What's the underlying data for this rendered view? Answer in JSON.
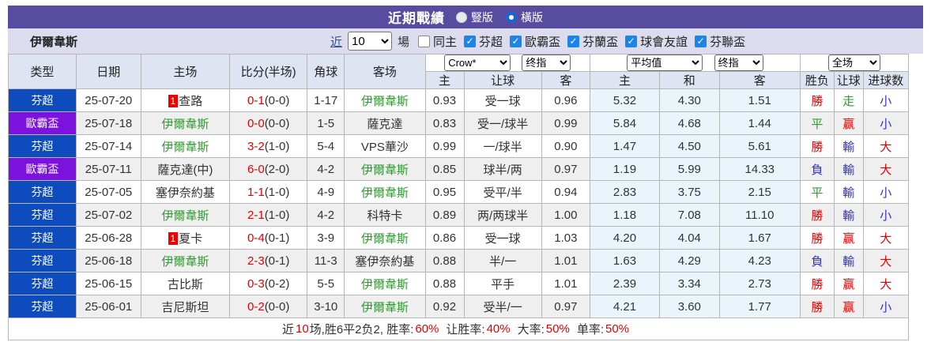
{
  "title_bar": {
    "title": "近期戰績",
    "radio_vertical_label": "豎版",
    "radio_horizontal_label": "橫版"
  },
  "filter_bar": {
    "team_name": "伊爾韋斯",
    "near_link": "近",
    "match_count": "10",
    "games_label": "場",
    "same_home_label": "同主",
    "league_filters": [
      "芬超",
      "歐霸盃",
      "芬蘭盃",
      "球會友誼",
      "芬聯盃"
    ]
  },
  "table": {
    "columns": {
      "type": "类型",
      "date": "日期",
      "home": "主场",
      "score": "比分(半场)",
      "corner": "角球",
      "away": "客场",
      "sub_home": "主",
      "sub_handicap": "让球",
      "sub_away": "客",
      "sub_avg_home": "主",
      "sub_avg_draw": "和",
      "sub_avg_away": "客",
      "sub_wdl": "胜负",
      "sub_hcap_result": "让球",
      "sub_goals": "进球数"
    },
    "selects": {
      "odds_company": "Crow*",
      "odds_stage": "终指",
      "average": "平均值",
      "average_stage": "终指",
      "scope": "全场"
    },
    "rows": [
      {
        "type": "芬超",
        "type_color": "blue",
        "date": "25-07-20",
        "home": {
          "rank": "1",
          "name": "查路",
          "green": false
        },
        "score_ft": "0-1",
        "score_ht": "(0-0)",
        "corner": "1-17",
        "away": {
          "name": "伊爾韋斯",
          "green": true
        },
        "handicap_home": "0.93",
        "handicap": "受一球",
        "handicap_away": "0.96",
        "avg_home": "5.32",
        "avg_draw": "4.30",
        "avg_away": "1.51",
        "result_wdl": {
          "t": "勝",
          "c": "red"
        },
        "result_handicap": {
          "t": "走",
          "c": "green"
        },
        "result_goals": {
          "t": "小",
          "c": "blue"
        }
      },
      {
        "type": "歐霸盃",
        "type_color": "purple",
        "date": "25-07-18",
        "home": {
          "name": "伊爾韋斯",
          "green": true
        },
        "score_ft": "0-0",
        "score_ht": "(0-0)",
        "corner": "1-5",
        "away": {
          "name": "薩克達",
          "green": false
        },
        "handicap_home": "0.83",
        "handicap": "受一/球半",
        "handicap_away": "0.99",
        "avg_home": "5.84",
        "avg_draw": "4.68",
        "avg_away": "1.44",
        "result_wdl": {
          "t": "平",
          "c": "green"
        },
        "result_handicap": {
          "t": "赢",
          "c": "red"
        },
        "result_goals": {
          "t": "小",
          "c": "blue"
        }
      },
      {
        "type": "芬超",
        "type_color": "blue",
        "date": "25-07-14",
        "home": {
          "name": "伊爾韋斯",
          "green": true
        },
        "score_ft": "3-2",
        "score_ht": "(1-0)",
        "corner": "5-4",
        "away": {
          "name": "VPS華沙",
          "green": false
        },
        "handicap_home": "0.99",
        "handicap": "一/球半",
        "handicap_away": "0.90",
        "avg_home": "1.47",
        "avg_draw": "4.50",
        "avg_away": "5.61",
        "result_wdl": {
          "t": "勝",
          "c": "red"
        },
        "result_handicap": {
          "t": "輸",
          "c": "blue"
        },
        "result_goals": {
          "t": "大",
          "c": "red"
        }
      },
      {
        "type": "歐霸盃",
        "type_color": "purple",
        "date": "25-07-11",
        "home": {
          "name": "薩克達(中)",
          "green": false
        },
        "score_ft": "6-0",
        "score_ht": "(2-0)",
        "corner": "4-2",
        "away": {
          "name": "伊爾韋斯",
          "green": true
        },
        "handicap_home": "0.85",
        "handicap": "球半/两",
        "handicap_away": "0.97",
        "avg_home": "1.19",
        "avg_draw": "5.99",
        "avg_away": "14.33",
        "result_wdl": {
          "t": "負",
          "c": "blue"
        },
        "result_handicap": {
          "t": "輸",
          "c": "blue"
        },
        "result_goals": {
          "t": "大",
          "c": "red"
        }
      },
      {
        "type": "芬超",
        "type_color": "blue",
        "date": "25-07-05",
        "home": {
          "name": "塞伊奈約基",
          "green": false
        },
        "score_ft": "1-1",
        "score_ht": "(1-0)",
        "corner": "4-9",
        "away": {
          "name": "伊爾韋斯",
          "green": true
        },
        "handicap_home": "0.95",
        "handicap": "受平/半",
        "handicap_away": "0.94",
        "avg_home": "2.83",
        "avg_draw": "3.75",
        "avg_away": "2.15",
        "result_wdl": {
          "t": "平",
          "c": "green"
        },
        "result_handicap": {
          "t": "輸",
          "c": "blue"
        },
        "result_goals": {
          "t": "小",
          "c": "blue"
        }
      },
      {
        "type": "芬超",
        "type_color": "blue",
        "date": "25-07-02",
        "home": {
          "name": "伊爾韋斯",
          "green": true
        },
        "score_ft": "2-1",
        "score_ht": "(1-0)",
        "corner": "4-2",
        "away": {
          "name": "科特卡",
          "green": false
        },
        "handicap_home": "0.89",
        "handicap": "两/两球半",
        "handicap_away": "1.00",
        "avg_home": "1.18",
        "avg_draw": "7.08",
        "avg_away": "11.10",
        "result_wdl": {
          "t": "勝",
          "c": "red"
        },
        "result_handicap": {
          "t": "輸",
          "c": "blue"
        },
        "result_goals": {
          "t": "小",
          "c": "blue"
        }
      },
      {
        "type": "芬超",
        "type_color": "blue",
        "date": "25-06-28",
        "home": {
          "rank": "1",
          "name": "夏卡",
          "green": false
        },
        "score_ft": "0-4",
        "score_ht": "(0-1)",
        "corner": "3-9",
        "away": {
          "name": "伊爾韋斯",
          "green": true
        },
        "handicap_home": "0.86",
        "handicap": "受一球",
        "handicap_away": "1.03",
        "avg_home": "4.20",
        "avg_draw": "4.04",
        "avg_away": "1.67",
        "result_wdl": {
          "t": "勝",
          "c": "red"
        },
        "result_handicap": {
          "t": "赢",
          "c": "red"
        },
        "result_goals": {
          "t": "大",
          "c": "red"
        }
      },
      {
        "type": "芬超",
        "type_color": "blue",
        "date": "25-06-18",
        "home": {
          "name": "伊爾韋斯",
          "green": true
        },
        "score_ft": "2-3",
        "score_ht": "(0-1)",
        "corner": "11-3",
        "away": {
          "name": "塞伊奈約基",
          "green": false
        },
        "handicap_home": "0.88",
        "handicap": "半/一",
        "handicap_away": "1.01",
        "avg_home": "1.63",
        "avg_draw": "4.29",
        "avg_away": "4.23",
        "result_wdl": {
          "t": "負",
          "c": "blue"
        },
        "result_handicap": {
          "t": "輸",
          "c": "blue"
        },
        "result_goals": {
          "t": "大",
          "c": "red"
        }
      },
      {
        "type": "芬超",
        "type_color": "blue",
        "date": "25-06-15",
        "home": {
          "name": "古比斯",
          "green": false
        },
        "score_ft": "0-3",
        "score_ht": "(0-2)",
        "corner": "5-5",
        "away": {
          "name": "伊爾韋斯",
          "green": true
        },
        "handicap_home": "0.88",
        "handicap": "平手",
        "handicap_away": "1.01",
        "avg_home": "2.39",
        "avg_draw": "3.34",
        "avg_away": "2.73",
        "result_wdl": {
          "t": "勝",
          "c": "red"
        },
        "result_handicap": {
          "t": "赢",
          "c": "red"
        },
        "result_goals": {
          "t": "大",
          "c": "red"
        }
      },
      {
        "type": "芬超",
        "type_color": "blue",
        "date": "25-06-01",
        "home": {
          "name": "吉尼斯坦",
          "green": false
        },
        "score_ft": "0-2",
        "score_ht": "(0-0)",
        "corner": "3-10",
        "away": {
          "name": "伊爾韋斯",
          "green": true
        },
        "handicap_home": "0.92",
        "handicap": "受半/一",
        "handicap_away": "0.97",
        "avg_home": "4.21",
        "avg_draw": "3.60",
        "avg_away": "1.77",
        "result_wdl": {
          "t": "勝",
          "c": "red"
        },
        "result_handicap": {
          "t": "赢",
          "c": "red"
        },
        "result_goals": {
          "t": "小",
          "c": "blue"
        }
      }
    ]
  },
  "summary": {
    "t1": "近",
    "n1": "10",
    "t2": "场,胜6平2负2, 胜率:",
    "n2": "60%",
    "t3": "让胜率:",
    "n3": "40%",
    "t4": "大率:",
    "n4": "50%",
    "t5": "单率:",
    "n5": "50%"
  },
  "colors": {
    "top_bar": "#584CA0",
    "league_blue": "#0E4BBD",
    "league_purple": "#7C12DD",
    "win_red": "#E60000",
    "draw_green": "#2E9B2E",
    "loss_blue": "#3030CC",
    "avg_bg": "#E9F5FB"
  }
}
